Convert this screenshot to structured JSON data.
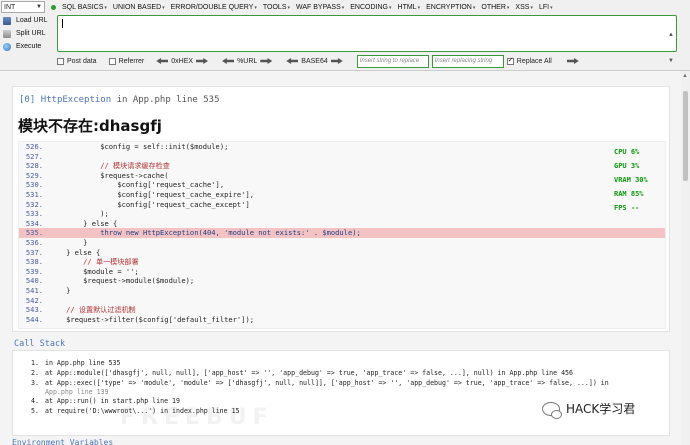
{
  "hackbar": {
    "select_value": "INT",
    "menu": [
      "SQL BASICS",
      "UNION BASED",
      "ERROR/DOUBLE QUERY",
      "TOOLS",
      "WAF BYPASS",
      "ENCODING",
      "HTML",
      "ENCRYPTION",
      "OTHER",
      "XSS",
      "LFI"
    ],
    "actions": {
      "load": "Load URL",
      "split": "Split URL",
      "execute": "Execute"
    },
    "options": {
      "post_data": "Post data",
      "referrer": "Referrer",
      "hex": "0xHEX",
      "url": "%URL",
      "base64": "BASE64",
      "insert_placeholder": "Insert string to replace",
      "replacing_placeholder": "Insert replacing string",
      "replace_all": "Replace All"
    },
    "accent_color": "#3a9a3a"
  },
  "exception": {
    "index": "[0]",
    "class": "HttpException",
    "location": "in App.php line 535",
    "message": "模块不存在:dhasgfj"
  },
  "code": [
    {
      "n": "526.",
      "t": "            $config = self::init($module);"
    },
    {
      "n": "527.",
      "t": ""
    },
    {
      "n": "528.",
      "t": "            // 模块请求缓存检查"
    },
    {
      "n": "529.",
      "t": "            $request->cache("
    },
    {
      "n": "530.",
      "t": "                $config['request_cache'],"
    },
    {
      "n": "531.",
      "t": "                $config['request_cache_expire'],"
    },
    {
      "n": "532.",
      "t": "                $config['request_cache_except']"
    },
    {
      "n": "533.",
      "t": "            );"
    },
    {
      "n": "534.",
      "t": "        } else {"
    },
    {
      "n": "535.",
      "t": "            throw new HttpException(404, 'module not exists:' . $module);"
    },
    {
      "n": "536.",
      "t": "        }"
    },
    {
      "n": "537.",
      "t": "    } else {"
    },
    {
      "n": "538.",
      "t": "        // 单一模块部署"
    },
    {
      "n": "539.",
      "t": "        $module = '';"
    },
    {
      "n": "540.",
      "t": "        $request->module($module);"
    },
    {
      "n": "541.",
      "t": "    }"
    },
    {
      "n": "542.",
      "t": ""
    },
    {
      "n": "543.",
      "t": "    // 设置默认过滤机制"
    },
    {
      "n": "544.",
      "t": "    $request->filter($config['default_filter']);"
    }
  ],
  "metrics": [
    "CPU  6%",
    "GPU  3%",
    "VRAM 30%",
    "RAM  85%",
    "FPS --"
  ],
  "call_stack_title": "Call Stack",
  "stack": [
    {
      "i": "1.",
      "t": "in App.php line 535"
    },
    {
      "i": "2.",
      "t": "at App::module(['dhasgfj', null, null], ['app_host' => '', 'app_debug' => true, 'app_trace' => false, ...], null) in App.php line 456"
    },
    {
      "i": "3.",
      "t": "at App::exec(['type' => 'module', 'module' => ['dhasgfj', null, null]], ['app_host' => '', 'app_debug' => true, 'app_trace' => false, ...]) in",
      "wrap": "App.php line 139"
    },
    {
      "i": "4.",
      "t": "at App::run() in start.php line 19"
    },
    {
      "i": "5.",
      "t": "at require('D:\\wwwroot\\...') in index.php line 15"
    }
  ],
  "bottom_cut": "Environment Variables",
  "watermark": "HACK学习君",
  "faint_watermark": "FREEBUF"
}
